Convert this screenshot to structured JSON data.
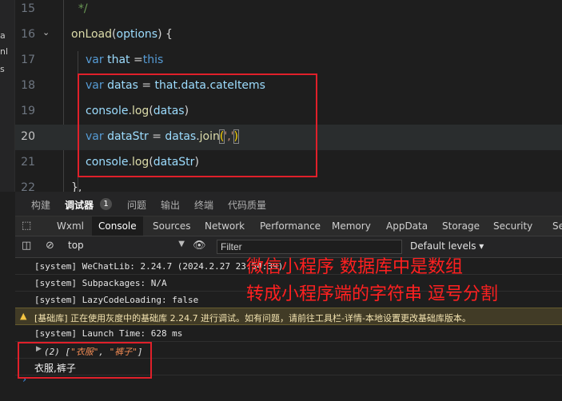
{
  "sidebar_fragments": [
    "a",
    "nl",
    "s"
  ],
  "editor": {
    "lines": [
      {
        "num": "15",
        "text": "  */"
      },
      {
        "num": "16",
        "text": "onLoad(options) {"
      },
      {
        "num": "17",
        "text": "var that =this"
      },
      {
        "num": "18",
        "text": "var datas = that.data.cateItems"
      },
      {
        "num": "19",
        "text": "console.log(datas)"
      },
      {
        "num": "20",
        "text": "var dataStr = datas.join(',')"
      },
      {
        "num": "21",
        "text": "console.log(dataStr)"
      },
      {
        "num": "22",
        "text": "},"
      }
    ]
  },
  "panel_tabs": [
    "构建",
    "调试器",
    "问题",
    "输出",
    "终端",
    "代码质量"
  ],
  "panel_badge": "1",
  "devtools_tabs": [
    "Wxml",
    "Console",
    "Sources",
    "Network",
    "Performance",
    "Memory",
    "AppData",
    "Storage",
    "Security",
    "Se"
  ],
  "toolbar": {
    "context": "top",
    "filter_placeholder": "Filter",
    "levels": "Default levels"
  },
  "console": {
    "rows": [
      "[system] WeChatLib: 2.24.7 (2024.2.27 23:54:39)",
      "[system] Subpackages: N/A",
      "[system] LazyCodeLoading: false",
      "[基础库] 正在使用灰度中的基础库 2.24.7 进行调试。如有问题，请前往工具栏-详情-本地设置更改基础库版本。",
      "[system] Launch Time: 628 ms"
    ],
    "array_count": "(2)",
    "array_items": [
      "\"衣服\"",
      "\"裤子\""
    ],
    "joined_output": "衣服,裤子",
    "prompt": "›"
  },
  "annotation": {
    "line1": "微信小程序 数据库中是数组",
    "line2": "转成小程序端的字符串 逗号分割"
  }
}
